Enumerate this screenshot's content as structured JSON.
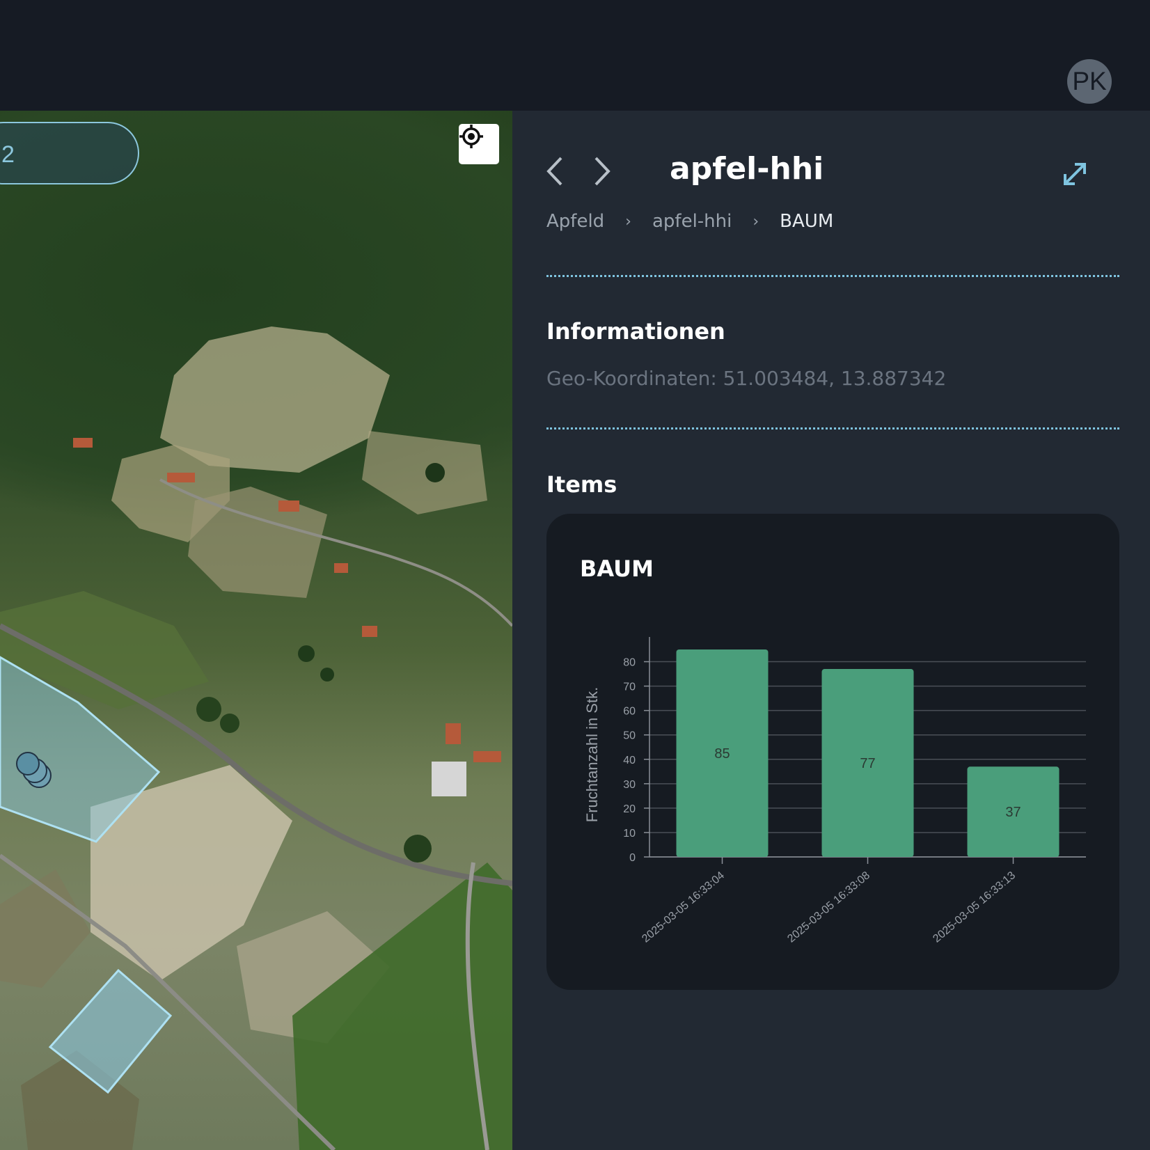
{
  "header": {
    "avatar_initials": "PK"
  },
  "map": {
    "layer_select_value": "2",
    "locate_label": "locate-icon"
  },
  "panel": {
    "title": "apfel-hhi",
    "breadcrumb": [
      "Apfeld",
      "apfel-hhi",
      "BAUM"
    ],
    "info_heading": "Informationen",
    "geo_coordinates": "Geo-Koordinaten: 51.003484, 13.887342",
    "items_heading": "Items",
    "card_title": "BAUM"
  },
  "colors": {
    "bar": "#4a9e7b",
    "accent": "#7fc4e0",
    "panel_bg": "#222933",
    "card_bg": "#161b22"
  },
  "chart_data": {
    "type": "bar",
    "categories": [
      "2025-03-05 16:33:04",
      "2025-03-05 16:33:08",
      "2025-03-05 16:33:13"
    ],
    "values": [
      85,
      77,
      37
    ],
    "ylabel": "Fruchtanzahl in Stk.",
    "xlabel": "",
    "ylim": [
      0,
      85
    ],
    "yticks": [
      0,
      10,
      20,
      30,
      40,
      50,
      60,
      70,
      80
    ],
    "grid": true,
    "data_labels": true
  }
}
